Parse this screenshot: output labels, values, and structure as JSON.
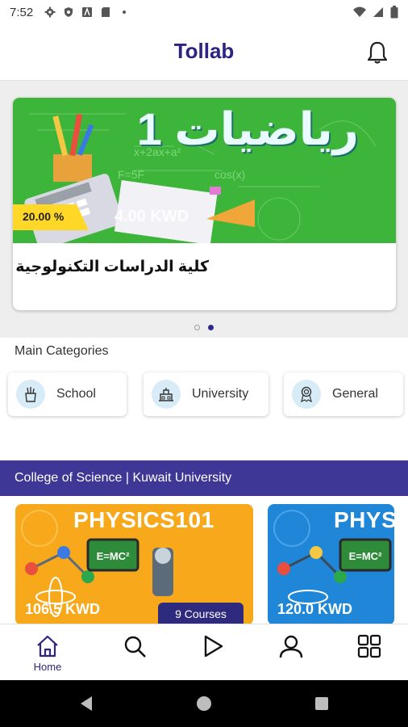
{
  "status_bar": {
    "time": "7:52",
    "left_icons": [
      "gear-icon",
      "shield-icon",
      "font-icon",
      "sd-card-icon",
      "dot-icon"
    ],
    "right_icons": [
      "wifi-icon",
      "signal-icon",
      "battery-icon"
    ]
  },
  "app_bar": {
    "title": "Tollab",
    "notification_icon": "bell-icon"
  },
  "banner": {
    "title_arabic": "رياضيات 1",
    "discount": "20.00 %",
    "price": "4.00 KWD",
    "caption": "كلية الدراسات التكنولوجية",
    "page_count": 2,
    "active_page": 2
  },
  "categories": {
    "title": "Main Categories",
    "items": [
      {
        "label": "School",
        "icon": "pencil-cup-icon"
      },
      {
        "label": "University",
        "icon": "building-icon"
      },
      {
        "label": "General",
        "icon": "award-icon"
      }
    ]
  },
  "section": {
    "title": "College of Science | Kuwait University",
    "courses": [
      {
        "title": "PHYSICS101",
        "price": "106.5 KWD",
        "count": "9 Courses",
        "color": "#f7a81b"
      },
      {
        "title": "PHYSICS",
        "price": "120.0 KWD",
        "count": "",
        "color": "#1f86d8"
      }
    ]
  },
  "bottom_nav": {
    "items": [
      {
        "label": "Home",
        "icon": "home-icon",
        "active": true
      },
      {
        "label": "",
        "icon": "search-icon"
      },
      {
        "label": "",
        "icon": "play-icon"
      },
      {
        "label": "",
        "icon": "profile-icon"
      },
      {
        "label": "",
        "icon": "grid-icon"
      }
    ]
  },
  "system_nav": {
    "icons": [
      "back-icon",
      "home-circle-icon",
      "recents-icon"
    ]
  },
  "colors": {
    "brand": "#2b2480",
    "section_bar": "#3f3796",
    "banner_green": "#3db53a",
    "badge_yellow": "#ffd726"
  }
}
